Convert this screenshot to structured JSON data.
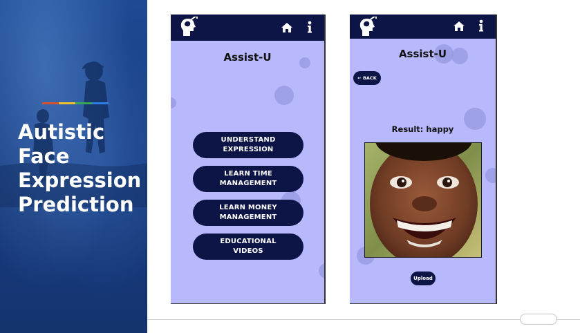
{
  "slide": {
    "title_lines": [
      "Autistic",
      "Face",
      "Expression",
      "Prediction"
    ],
    "accent_colors": [
      "#d9502e",
      "#f2c12e",
      "#3aa757",
      "#2f7de1"
    ]
  },
  "app": {
    "name": "Assist-U",
    "bar_color": "#0d1547",
    "background_color": "#b7b9fc",
    "icons": [
      "brain-head-logo-icon",
      "home-icon",
      "info-icon"
    ]
  },
  "home_screen": {
    "menu": [
      {
        "line1": "UNDERSTAND",
        "line2": "EXPRESSION"
      },
      {
        "line1": "LEARN TIME",
        "line2": "MANAGEMENT"
      },
      {
        "line1": "LEARN MONEY",
        "line2": "MANAGEMENT"
      },
      {
        "line1": "EDUCATIONAL",
        "line2": "VIDEOS"
      }
    ]
  },
  "result_screen": {
    "back_label": "← BACK",
    "result_text": "Result: happy",
    "upload_label": "Upload",
    "photo_description_icon": "smiling-child-photo"
  }
}
